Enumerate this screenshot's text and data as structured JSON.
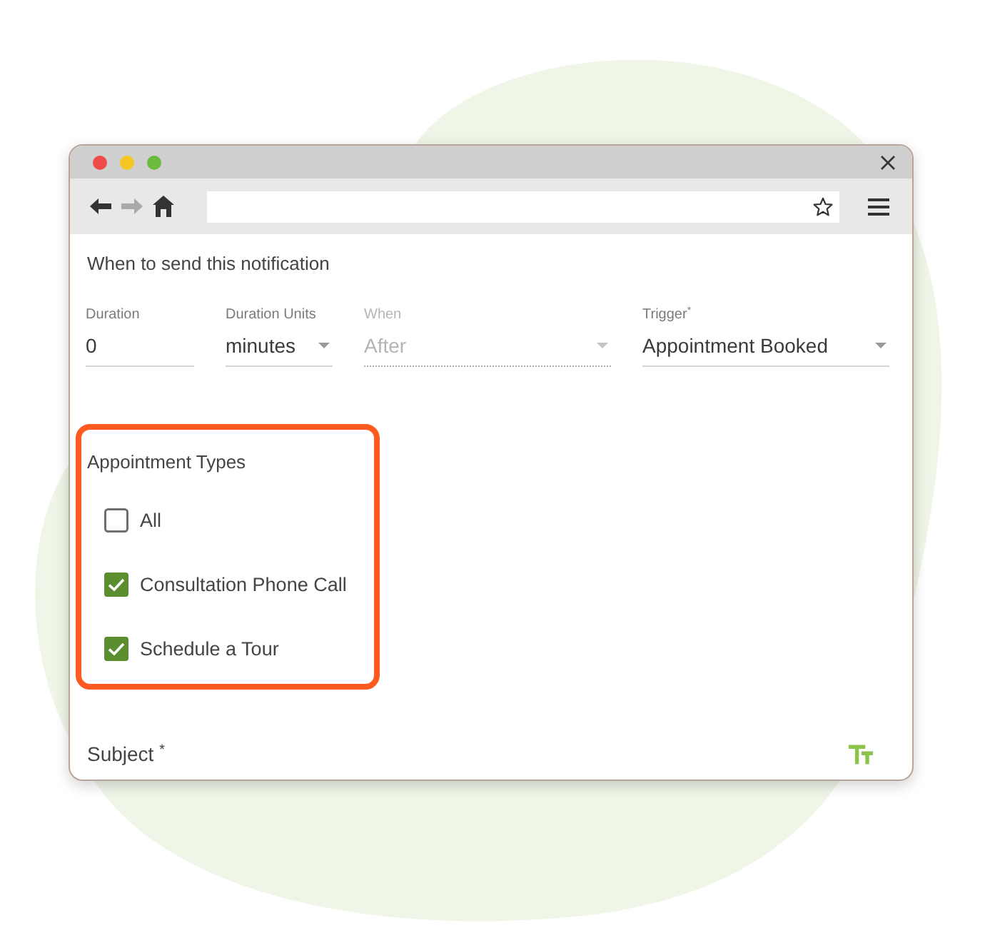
{
  "notification": {
    "heading": "When to send this notification",
    "fields": [
      {
        "label": "Duration",
        "value": "0",
        "kind": "text",
        "disabled": false
      },
      {
        "label": "Duration Units",
        "value": "minutes",
        "kind": "select",
        "disabled": false
      },
      {
        "label": "When",
        "value": "After",
        "kind": "select",
        "disabled": true
      },
      {
        "label": "Trigger$^{*}$",
        "value": "Appointment Booked",
        "kind": "select",
        "disabled": false
      }
    ]
  },
  "appointment_types": {
    "title": "Appointment Types",
    "highlighted": true,
    "options": [
      {
        "label": "All",
        "checked": false
      },
      {
        "label": "Consultation Phone Call",
        "checked": true
      },
      {
        "label": "Schedule a Tour",
        "checked": true
      }
    ]
  },
  "subject": {
    "label": "Subject $^{*}$"
  }
}
